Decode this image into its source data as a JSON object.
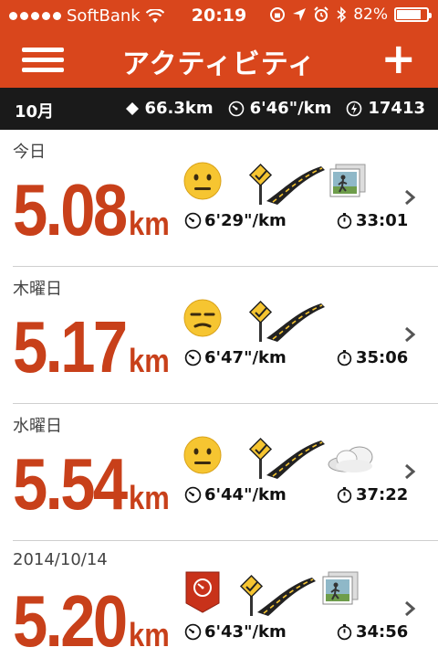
{
  "status_bar": {
    "carrier": "SoftBank",
    "time": "20:19",
    "battery_text": "82%",
    "battery_level": 0.82
  },
  "nav": {
    "title": "アクティビティ",
    "add_label": "+"
  },
  "summary": {
    "month": "10月",
    "distance": "66.3km",
    "pace": "6'46\"/km",
    "fuel": "17413"
  },
  "activities": [
    {
      "date": "今日",
      "distance": "5.08",
      "unit": "km",
      "pace": "6'29\"/km",
      "duration": "33:01",
      "mood": "neutral",
      "terrain": "road",
      "extra": "photo"
    },
    {
      "date": "木曜日",
      "distance": "5.17",
      "unit": "km",
      "pace": "6'47\"/km",
      "duration": "35:06",
      "mood": "tired",
      "terrain": "road",
      "extra": ""
    },
    {
      "date": "水曜日",
      "distance": "5.54",
      "unit": "km",
      "pace": "6'44\"/km",
      "duration": "37:22",
      "mood": "neutral",
      "terrain": "road",
      "extra": "cloud"
    },
    {
      "date": "2014/10/14",
      "distance": "5.20",
      "unit": "km",
      "pace": "6'43\"/km",
      "duration": "34:56",
      "mood": "badge",
      "terrain": "road",
      "extra": "photo"
    }
  ],
  "colors": {
    "brand": "#d9461c",
    "distance": "#c8401a",
    "summary_bg": "#1a1a1a"
  }
}
